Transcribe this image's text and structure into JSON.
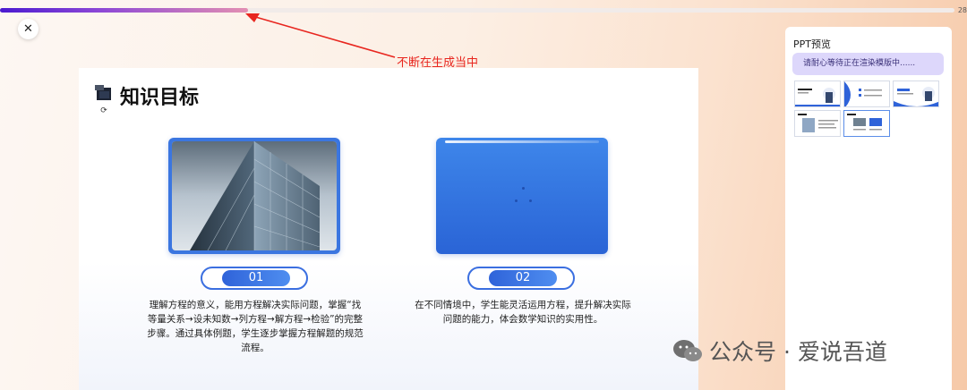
{
  "progress": {
    "value": 0.26,
    "label": "28"
  },
  "annotation": {
    "text": "不断在生成当中"
  },
  "slide": {
    "title": "知识目标",
    "items": [
      {
        "number": "01",
        "text": "理解方程的意义，能用方程解决实际问题，掌握“找等量关系→设未知数→列方程→解方程→检验”的完整步骤。通过具体例题，学生逐步掌握方程解题的规范流程。"
      },
      {
        "number": "02",
        "text": "在不同情境中，学生能灵活运用方程，提升解决实际问题的能力，体会数学知识的实用性。"
      }
    ]
  },
  "preview": {
    "title": "PPT预览",
    "status": "请耐心等待正在渲染模版中......"
  },
  "watermark": {
    "text": "公众号 · 爱说吾道"
  },
  "colors": {
    "accent": "#3b6fe0",
    "annotation": "#e8261f",
    "status_bg": "#ddd7fb"
  }
}
